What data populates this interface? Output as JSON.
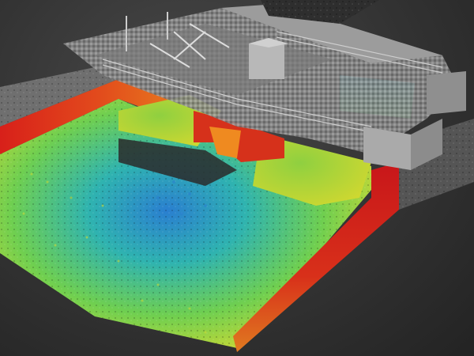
{
  "scene": {
    "subject": "point-cloud-scan-lock-structure",
    "colormap": [
      "#1f4fbf",
      "#2fb3c9",
      "#3fc97a",
      "#c9d936",
      "#f0a020",
      "#e0301c"
    ],
    "background_color": "#3a3a3a",
    "structure_color": "#9a9a9a"
  }
}
